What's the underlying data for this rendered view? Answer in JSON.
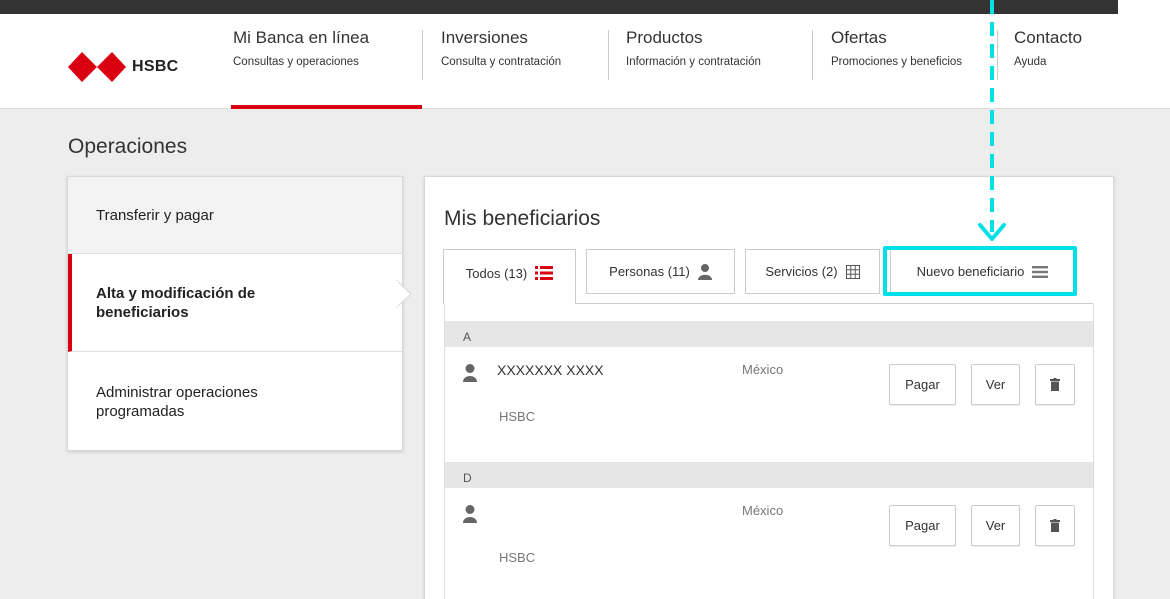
{
  "brand": {
    "name": "HSBC",
    "color": "#db0011"
  },
  "nav": [
    {
      "title": "Mi Banca en línea",
      "subtitle": "Consultas y operaciones",
      "active": true
    },
    {
      "title": "Inversiones",
      "subtitle": "Consulta y contratación"
    },
    {
      "title": "Productos",
      "subtitle": "Información y contratación"
    },
    {
      "title": "Ofertas",
      "subtitle": "Promociones y beneficios"
    },
    {
      "title": "Contacto",
      "subtitle": "Ayuda"
    }
  ],
  "page": {
    "title": "Operaciones"
  },
  "sidenav": [
    {
      "label": "Transferir y pagar"
    },
    {
      "label": "Alta y modificación de beneficiarios",
      "active": true
    },
    {
      "label": "Administrar operaciones programadas"
    }
  ],
  "panel": {
    "title": "Mis beneficiarios",
    "tabs": [
      {
        "label": "Todos (13)",
        "icon": "list-icon",
        "active": true
      },
      {
        "label": "Personas (11)",
        "icon": "person-icon"
      },
      {
        "label": "Servicios (2)",
        "icon": "building-icon"
      },
      {
        "label": "Nuevo beneficiario",
        "icon": "menu-icon"
      }
    ],
    "groups": [
      {
        "letter": "A",
        "rows": [
          {
            "name": "XXXXXXX XXXX",
            "country": "México",
            "bank": "HSBC"
          }
        ]
      },
      {
        "letter": "D",
        "rows": [
          {
            "name": "",
            "country": "México",
            "bank": "HSBC"
          }
        ]
      }
    ],
    "actions": {
      "pay": "Pagar",
      "view": "Ver"
    }
  },
  "annotation": {
    "color": "#00e0e8"
  }
}
